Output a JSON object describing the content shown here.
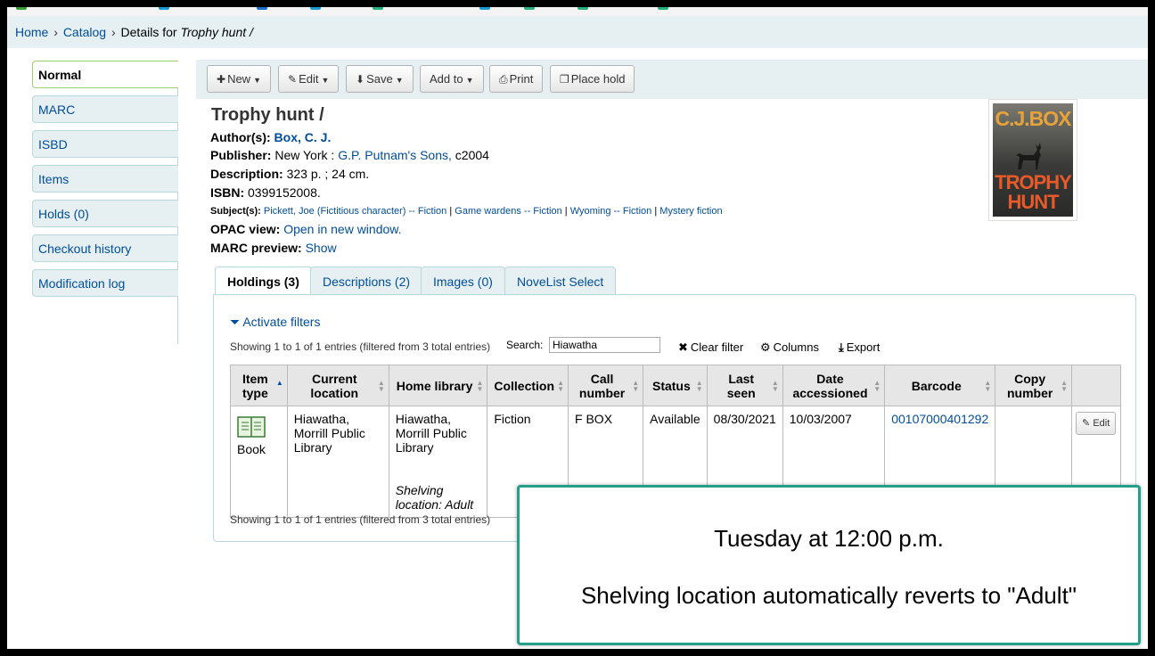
{
  "breadcrumb": {
    "home": "Home",
    "catalog": "Catalog",
    "details_prefix": "Details for",
    "details_title": "Trophy hunt /",
    "separator": "›"
  },
  "sidebar": {
    "items": [
      {
        "label": "Normal",
        "active": true
      },
      {
        "label": "MARC"
      },
      {
        "label": "ISBD"
      },
      {
        "label": "Items"
      },
      {
        "label": "Holds (0)"
      },
      {
        "label": "Checkout history"
      },
      {
        "label": "Modification log"
      }
    ]
  },
  "toolbar": {
    "new_label": "New",
    "edit_label": "Edit",
    "save_label": "Save",
    "addto_label": "Add to",
    "print_label": "Print",
    "placehold_label": "Place hold"
  },
  "record": {
    "title": "Trophy hunt /",
    "author_label": "Author(s):",
    "author": "Box, C. J.",
    "publisher_label": "Publisher:",
    "publisher_place": "New York :",
    "publisher_name": "G.P. Putnam's Sons,",
    "publisher_year": "c2004",
    "description_label": "Description:",
    "description": "323 p. ; 24 cm.",
    "isbn_label": "ISBN:",
    "isbn": "0399152008.",
    "subjects_label": "Subject(s):",
    "subjects": [
      "Pickett, Joe (Fictitious character) -- Fiction",
      "Game wardens -- Fiction",
      "Wyoming -- Fiction",
      "Mystery fiction"
    ],
    "subject_sep": "|",
    "opac_label": "OPAC view:",
    "opac_link": "Open in new window.",
    "marc_label": "MARC preview:",
    "marc_link": "Show"
  },
  "cover": {
    "author": "C.J.BOX",
    "title_line1": "TROPHY",
    "title_line2": "HUNT"
  },
  "tabs": [
    {
      "label": "Holdings (3)",
      "active": true
    },
    {
      "label": "Descriptions (2)"
    },
    {
      "label": "Images (0)"
    },
    {
      "label": "NoveList Select"
    }
  ],
  "holdings": {
    "filters_label": "Activate filters",
    "showing_top": "Showing 1 to 1 of 1 entries (filtered from 3 total entries)",
    "showing_bottom": "Showing 1 to 1 of 1 entries (filtered from 3 total entries)",
    "search_label": "Search:",
    "search_value": "Hiawatha",
    "clear_filter": "Clear filter",
    "columns": "Columns",
    "export": "Export",
    "headers": [
      "Item type",
      "Current location",
      "Home library",
      "Collection",
      "Call number",
      "Status",
      "Last seen",
      "Date accessioned",
      "Barcode",
      "Copy number"
    ],
    "row": {
      "item_type": "Book",
      "current_location": "Hiawatha, Morrill Public Library",
      "home_library": "Hiawatha, Morrill Public Library",
      "shelving_location": "Shelving location: Adult",
      "collection": "Fiction",
      "call_number": "F BOX",
      "status": "Available",
      "last_seen": "08/30/2021",
      "date_accessioned": "10/03/2007",
      "barcode": "00107000401292",
      "copy_number": "",
      "edit_label": "Edit"
    }
  },
  "callout": {
    "line1": "Tuesday at 12:00 p.m.",
    "line2": "Shelving location automatically reverts to \"Adult\"",
    "border_color": "#24a08a"
  }
}
